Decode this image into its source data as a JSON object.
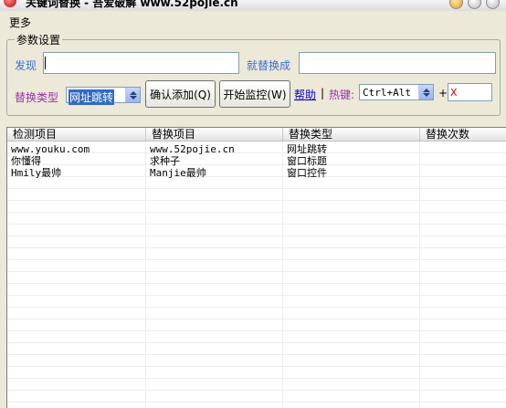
{
  "window": {
    "title": "关键词替换 - 吾爱破解 www.52pojie.cn"
  },
  "menu": {
    "items": [
      "更多"
    ]
  },
  "settings": {
    "group_label": "参数设置",
    "find_label": "发现",
    "find_value": "",
    "replace_label": "就替换成",
    "replace_value": "",
    "type_label": "替换类型",
    "type_selected": "网址跳转",
    "confirm_button": "确认添加(Q)",
    "monitor_button": "开始监控(W)",
    "help_link": "帮助",
    "separator": "|",
    "hotkey_label": "热键:",
    "hotkey_modifier": "Ctrl+Alt",
    "plus": "+",
    "hotkey_key": "X"
  },
  "table": {
    "columns": [
      "检测项目",
      "替换项目",
      "替换类型",
      "替换次数"
    ],
    "rows": [
      [
        "www.youku.com",
        "www.52pojie.cn",
        "网址跳转",
        ""
      ],
      [
        "你懂得",
        "求种子",
        "窗口标题",
        ""
      ],
      [
        "Hmily最帅",
        "Manjie最帅",
        "窗口控件",
        ""
      ]
    ]
  },
  "colors": {
    "label_blue": "#3a6fd8",
    "label_purple": "#9b2fae",
    "link": "#0000cc",
    "hotkey_red": "#cc0000"
  }
}
